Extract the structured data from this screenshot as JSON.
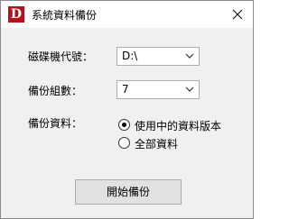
{
  "window": {
    "title": "系統資料備份",
    "icon_letter": "D",
    "icon_color": "#b5121b"
  },
  "form": {
    "drive_label": "磁碟機代號：",
    "drive_value": "D:\\",
    "copies_label": "備份組數：",
    "copies_value": "7",
    "data_label": "備份資料：",
    "options": [
      {
        "label": "使用中的資料版本",
        "selected": true
      },
      {
        "label": "全部資料",
        "selected": false
      }
    ]
  },
  "actions": {
    "start_label": "開始備份"
  }
}
